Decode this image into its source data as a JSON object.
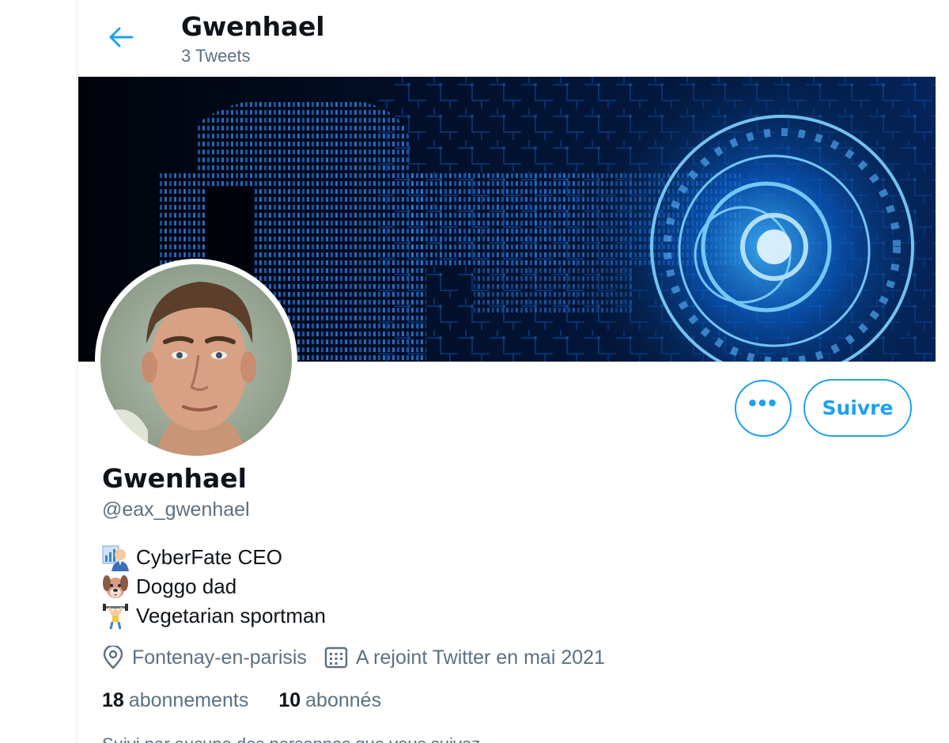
{
  "header": {
    "title": "Gwenhael",
    "tweet_count": "3 Tweets"
  },
  "profile": {
    "name": "Gwenhael",
    "handle": "@eax_gwenhael",
    "bio": [
      {
        "icon": "man-office-worker-emoji",
        "text": "CyberFate CEO"
      },
      {
        "icon": "dog-face-emoji",
        "text": "Doggo dad"
      },
      {
        "icon": "weightlifter-emoji",
        "text": "Vegetarian sportman"
      }
    ],
    "location": "Fontenay-en-parisis",
    "joined": "A rejoint Twitter en mai 2021",
    "following_count": "18",
    "following_label": "abonnements",
    "followers_count": "10",
    "followers_label": "abonnés",
    "followed_by": "Suivi par aucune des personnes que vous suivez"
  },
  "actions": {
    "more_label": "•••",
    "follow_label": "Suivre"
  },
  "colors": {
    "accent": "#1da1f2",
    "secondary_text": "#5b7083",
    "primary_text": "#0f1419"
  },
  "icons": {
    "back": "arrow-left-icon",
    "location": "map-pin-icon",
    "calendar": "calendar-icon"
  }
}
